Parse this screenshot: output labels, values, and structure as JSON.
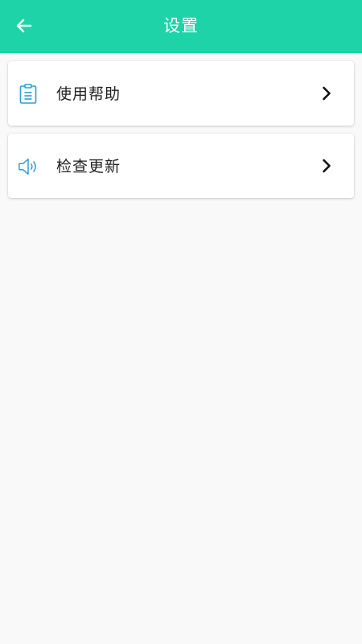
{
  "header": {
    "title": "设置",
    "back_icon": "arrow-left-icon"
  },
  "menu": {
    "items": [
      {
        "label": "使用帮助",
        "icon": "document-icon"
      },
      {
        "label": "检查更新",
        "icon": "speaker-icon"
      }
    ]
  },
  "colors": {
    "header_bg": "#1dd3a7",
    "icon_accent": "#2a9fd6",
    "background": "#f9f9f9"
  }
}
